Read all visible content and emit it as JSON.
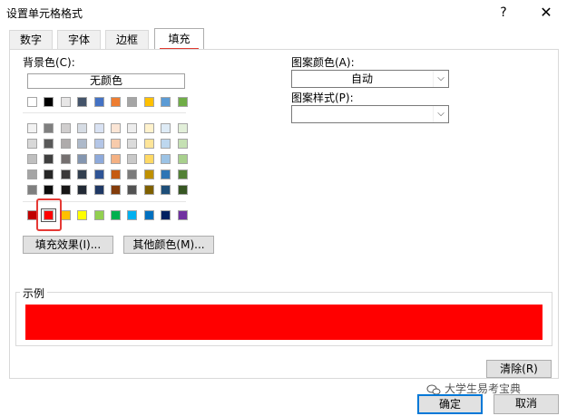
{
  "window": {
    "title": "设置单元格格式",
    "help": "?",
    "close": "✕"
  },
  "tabs": [
    {
      "label": "数字"
    },
    {
      "label": "字体"
    },
    {
      "label": "边框"
    },
    {
      "label": "填充"
    }
  ],
  "colors": {
    "accent": "#e03a30",
    "selected_fill": "#ff0000"
  },
  "background": {
    "label": "背景色(C):",
    "no_color": "无颜色",
    "theme_top": [
      "#ffffff",
      "#000000",
      "#e7e6e6",
      "#44546a",
      "#4472c4",
      "#ed7d31",
      "#a5a5a5",
      "#ffc000",
      "#5b9bd5",
      "#70ad47"
    ],
    "tints": [
      [
        "#f2f2f2",
        "#7f7f7f",
        "#d0cece",
        "#d6dce4",
        "#d9e2f3",
        "#fbe5d5",
        "#ededed",
        "#fff2cc",
        "#deebf6",
        "#e2efd9"
      ],
      [
        "#d8d8d8",
        "#595959",
        "#aeabab",
        "#adb9ca",
        "#b4c6e7",
        "#f7cbac",
        "#dbdbdb",
        "#fee599",
        "#bdd7ee",
        "#c5e0b3"
      ],
      [
        "#bfbfbf",
        "#3f3f3f",
        "#757070",
        "#8496b0",
        "#8eaadb",
        "#f4b183",
        "#c9c9c9",
        "#ffd965",
        "#9cc3e5",
        "#a8d08d"
      ],
      [
        "#a5a5a5",
        "#262626",
        "#3a3838",
        "#323f4f",
        "#2f5496",
        "#c55a11",
        "#7b7b7b",
        "#bf9000",
        "#2e75b5",
        "#538135"
      ],
      [
        "#7f7f7f",
        "#0c0c0c",
        "#171616",
        "#222a35",
        "#1f3864",
        "#833c0b",
        "#525252",
        "#7f6000",
        "#1e4e79",
        "#375623"
      ]
    ],
    "standard": [
      "#c00000",
      "#ff0000",
      "#ffc000",
      "#ffff00",
      "#92d050",
      "#00b050",
      "#00b0f0",
      "#0070c0",
      "#002060",
      "#7030a0"
    ],
    "selected_index": 1,
    "fill_effects_button": "填充效果(I)...",
    "more_colors_button": "其他颜色(M)..."
  },
  "pattern": {
    "color_label": "图案颜色(A):",
    "color_value": "自动",
    "style_label": "图案样式(P):",
    "style_value": ""
  },
  "sample": {
    "label": "示例"
  },
  "buttons": {
    "clear": "清除(R)",
    "ok": "确定",
    "cancel": "取消"
  },
  "watermark": "大学生易考宝典"
}
